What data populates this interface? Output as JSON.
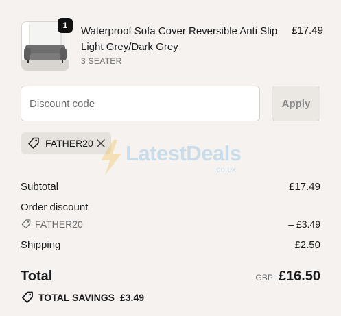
{
  "product": {
    "quantity": "1",
    "title": "Waterproof Sofa Cover Reversible Anti Slip Light Grey/Dark Grey",
    "variant": "3 SEATER",
    "price": "£17.49"
  },
  "discount": {
    "placeholder": "Discount code",
    "apply_label": "Apply",
    "applied_code": "FATHER20"
  },
  "watermark": {
    "brand": "LatestDeals",
    "suffix": ".co.uk"
  },
  "summary": {
    "subtotal_label": "Subtotal",
    "subtotal_value": "£17.49",
    "order_discount_label": "Order discount",
    "discount_code": "FATHER20",
    "discount_value": "– £3.49",
    "shipping_label": "Shipping",
    "shipping_value": "£2.50",
    "total_label": "Total",
    "currency": "GBP",
    "total_value": "£16.50",
    "savings_label": "TOTAL SAVINGS",
    "savings_value": "£3.49"
  },
  "icons": {
    "tag": "tag-icon",
    "close": "close-icon"
  },
  "colors": {
    "background": "#f5f2ef",
    "badge": "#111111",
    "watermark": "#5ba4e0"
  }
}
